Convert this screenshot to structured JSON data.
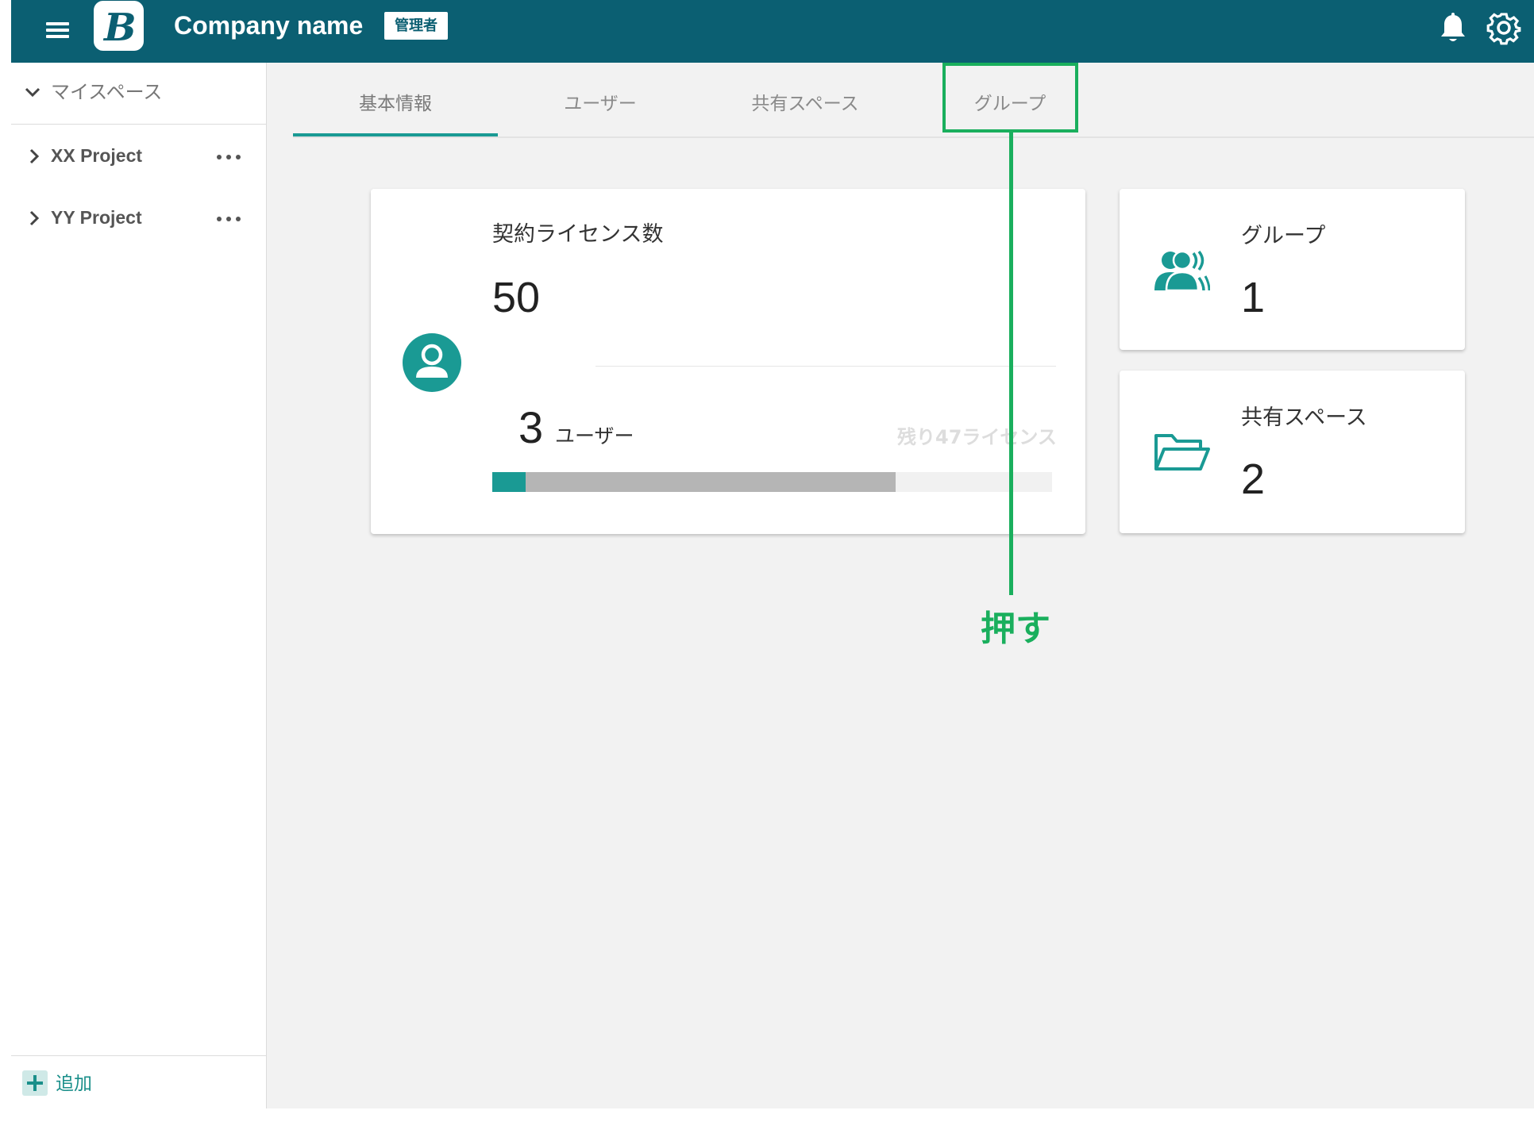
{
  "colors": {
    "header_bg": "#0b5f72",
    "accent": "#1a9a94",
    "callout": "#1aaf5d",
    "page_bg": "#f2f2f2"
  },
  "header": {
    "menu_icon": "hamburger-icon",
    "logo_letter": "B",
    "company_name": "Company name",
    "role_badge": "管理者",
    "notification_icon": "bell-icon",
    "settings_icon": "gear-icon"
  },
  "sidebar": {
    "myspace_label": "マイスペース",
    "projects": [
      {
        "label": "XX Project"
      },
      {
        "label": "YY Project"
      }
    ],
    "add_label": "追加"
  },
  "tabs": [
    {
      "label": "基本情報",
      "active": true
    },
    {
      "label": "ユーザー",
      "active": false
    },
    {
      "label": "共有スペース",
      "active": false
    },
    {
      "label": "グループ",
      "active": false
    }
  ],
  "license": {
    "title": "契約ライセンス数",
    "total": "50",
    "used": "3",
    "used_unit": "ユーザー",
    "remaining_text": "残り47ライセンス",
    "used_fraction": 0.06,
    "bar_total_fraction": 0.72
  },
  "stats": {
    "groups": {
      "title": "グループ",
      "value": "1",
      "icon": "group-icon"
    },
    "shared_spaces": {
      "title": "共有スペース",
      "value": "2",
      "icon": "folder-open-icon"
    }
  },
  "annotation": {
    "label": "押す"
  }
}
